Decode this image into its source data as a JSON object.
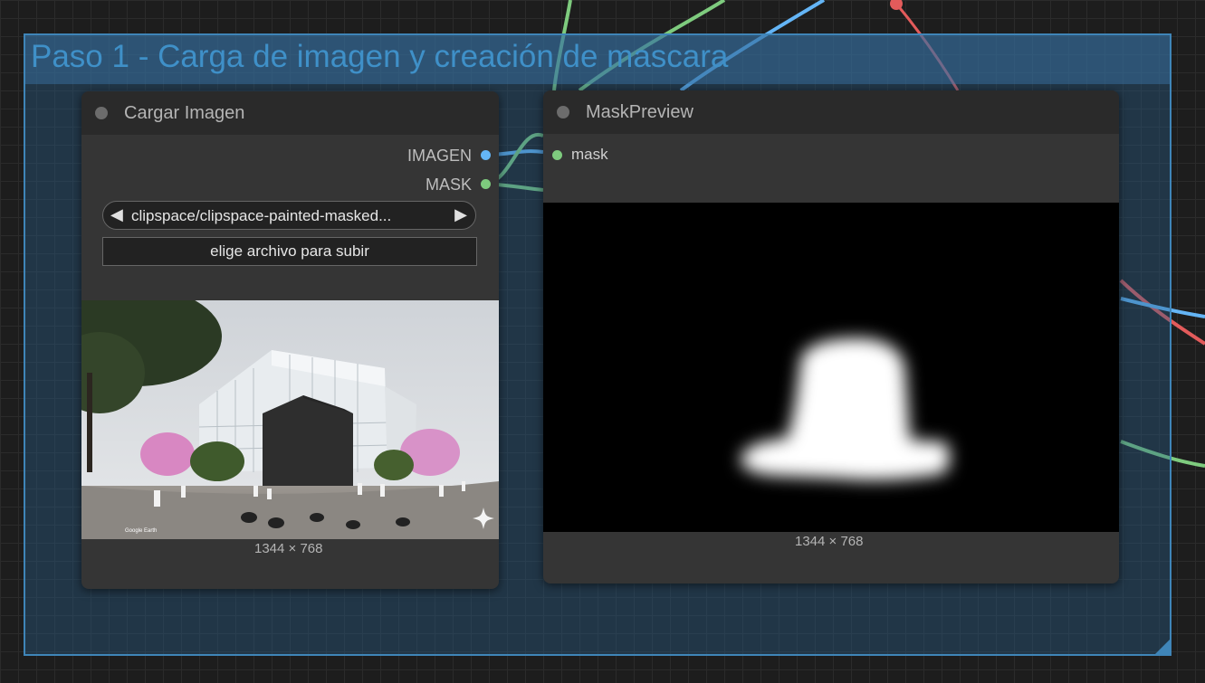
{
  "group": {
    "title": "Paso 1 - Carga de imagen y creación de mascara"
  },
  "load_image_node": {
    "title": "Cargar Imagen",
    "outputs": [
      {
        "label": "IMAGEN",
        "color": "#64b5f6"
      },
      {
        "label": "MASK",
        "color": "#7ecb7e"
      }
    ],
    "image_combo": {
      "value": "clipspace/clipspace-painted-masked...",
      "prev_arrow": "◀",
      "next_arrow": "▶"
    },
    "upload_button_label": "elige archivo para subir",
    "preview_dimensions": "1344 × 768",
    "preview_watermark": "Google Earth",
    "preview_badge_icon": "sparkle-icon"
  },
  "mask_preview_node": {
    "title": "MaskPreview",
    "input_label": "mask",
    "preview_dimensions": "1344 × 768"
  },
  "link_colors": {
    "image": "#64b5f6",
    "mask": "#7ecb7e",
    "red": "#e35b5b"
  }
}
